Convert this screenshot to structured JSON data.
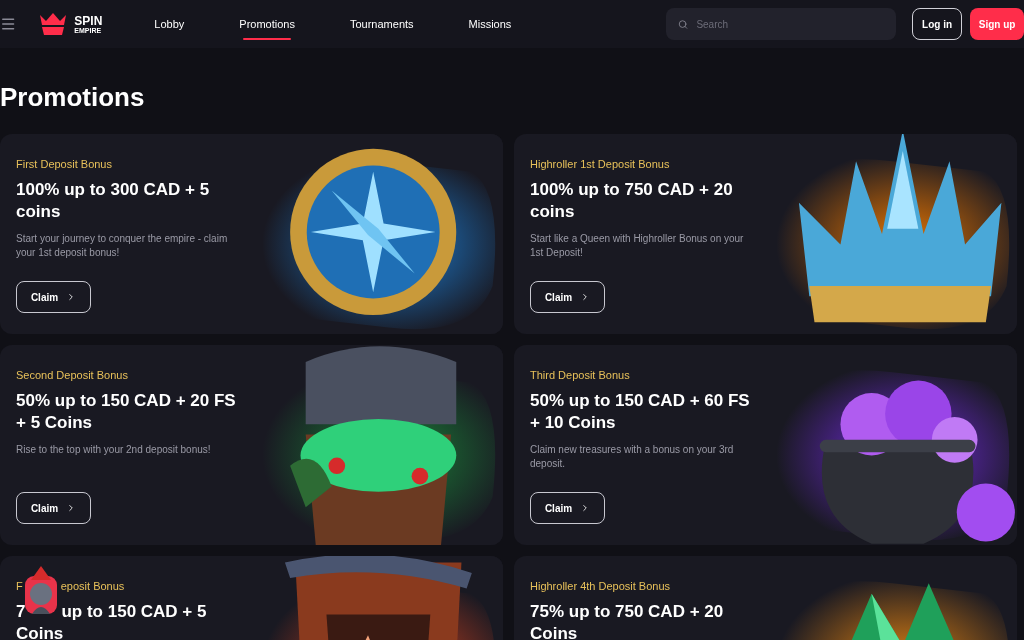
{
  "header": {
    "logo": {
      "line1": "SPIN",
      "line2": "EMPIRE"
    },
    "nav": [
      {
        "label": "Lobby",
        "selected": false
      },
      {
        "label": "Promotions",
        "selected": true
      },
      {
        "label": "Tournaments",
        "selected": false
      },
      {
        "label": "Missions",
        "selected": false
      }
    ],
    "search": {
      "placeholder": "Search"
    },
    "login": "Log in",
    "signup": "Sign up"
  },
  "page_title": "Promotions",
  "promotions": [
    {
      "label": [
        "First Deposit Bonus"
      ],
      "title": [
        "100% up to 300 CAD + 5 coins"
      ],
      "description": "Start your journey to conquer the empire - claim your 1st deposit bonus!",
      "button": "Claim"
    },
    {
      "label": [
        "Highroller 1st Deposit Bonus"
      ],
      "title": [
        "100% up to 750 CAD + 20 coins"
      ],
      "description": "Start like a Queen with Highroller Bonus on your 1st Deposit!",
      "button": "Claim"
    },
    {
      "label": [
        "Second Deposit Bonus"
      ],
      "title": [
        "50% up to 150 CAD + 20 FS + 5 Coins"
      ],
      "description": "Rise to the top with your 2nd deposit bonus!",
      "button": "Claim"
    },
    {
      "label": [
        "Third Deposit Bonus"
      ],
      "title": [
        "50% up to 150 CAD + 60 FS + 10 Coins"
      ],
      "description": "Claim new treasures with a bonus on your 3rd deposit.",
      "button": "Claim"
    },
    {
      "label": [
        "F",
        "eposit Bonus"
      ],
      "title": [
        "7",
        "up to 150 CAD + 5 Coins"
      ]
    },
    {
      "label": [
        "Highroller 4th Deposit Bonus"
      ],
      "title": [
        "75% up to 750 CAD + 20 Coins"
      ]
    }
  ]
}
